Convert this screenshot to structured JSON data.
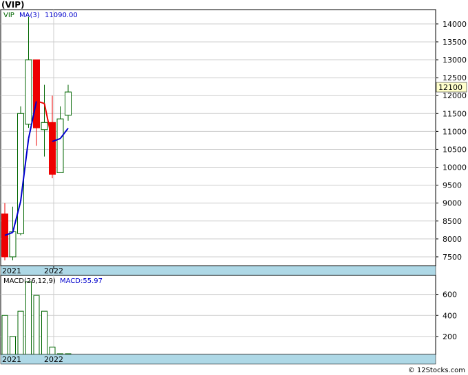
{
  "title": "(VIP)",
  "footer": "© 12Stocks.com",
  "colors": {
    "up_candle": "#006600",
    "down_candle": "#ee0000",
    "ma_up": "#0000cc",
    "ma_down": "#ee0000",
    "macd_bar": "#006600",
    "grid": "#cccccc",
    "axis_band": "#aed8e6",
    "last_price_bg": "#ffffcc"
  },
  "price_panel": {
    "legend": {
      "symbol": "VIP",
      "ma_label": "MA(3)",
      "ma_value": "11090.00"
    },
    "last_price_label": "12100",
    "x_labels": [
      "2021",
      "2022"
    ]
  },
  "macd_panel": {
    "legend": {
      "label": "MACD(26,12,9)",
      "value_label": "MACD:55.97"
    },
    "x_labels": [
      "2021",
      "2022"
    ]
  },
  "chart_data": [
    {
      "type": "candlestick",
      "title": "(VIP)",
      "y_ticks": [
        7500,
        8000,
        8500,
        9000,
        9500,
        10000,
        10500,
        11000,
        11500,
        12000,
        12500,
        13000,
        13500,
        14000
      ],
      "ylim": [
        7250,
        14400
      ],
      "grid": true,
      "candles": [
        {
          "open": 8700,
          "high": 9000,
          "low": 7400,
          "close": 7500
        },
        {
          "open": 7500,
          "high": 8900,
          "low": 7400,
          "close": 8200
        },
        {
          "open": 8150,
          "high": 11700,
          "low": 8100,
          "close": 11500
        },
        {
          "open": 11200,
          "high": 14200,
          "low": 11100,
          "close": 13000
        },
        {
          "open": 13000,
          "high": 13000,
          "low": 10600,
          "close": 11100
        },
        {
          "open": 11050,
          "high": 12300,
          "low": 10300,
          "close": 11250
        },
        {
          "open": 11250,
          "high": 12000,
          "low": 9700,
          "close": 9800
        },
        {
          "open": 9850,
          "high": 11700,
          "low": 9850,
          "close": 11350
        },
        {
          "open": 11450,
          "high": 12300,
          "low": 11300,
          "close": 12100
        }
      ],
      "ma": {
        "name": "MA(3)",
        "values": [
          8100,
          8180,
          9050,
          10800,
          11850,
          11780,
          10720,
          10800,
          11090
        ]
      }
    },
    {
      "type": "bar",
      "title": "MACD(26,12,9)",
      "y_ticks": [
        200,
        400,
        600
      ],
      "ylim": [
        30,
        780
      ],
      "grid": true,
      "values": [
        400,
        200,
        440,
        720,
        590,
        440,
        100,
        0,
        15
      ]
    }
  ]
}
